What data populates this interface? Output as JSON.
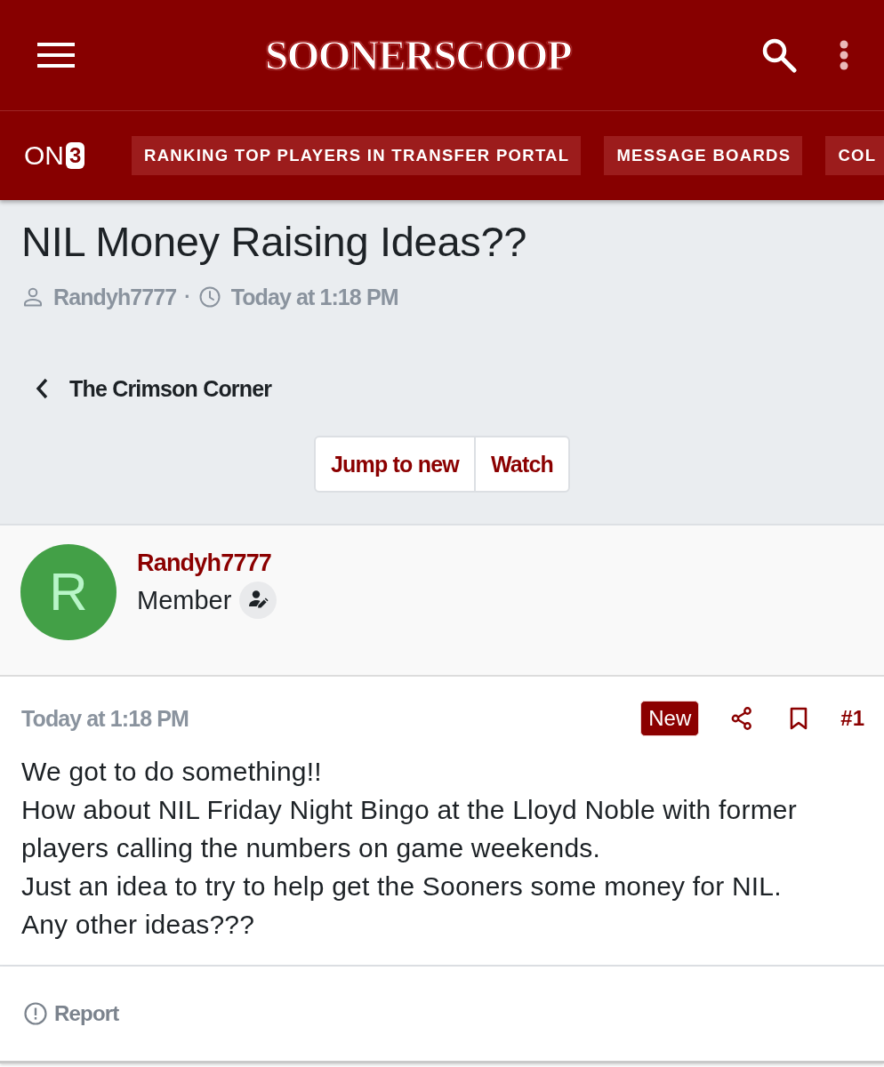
{
  "header": {
    "logo": "SOONERSCOOP"
  },
  "nav": {
    "brand": {
      "text": "ON",
      "badge": "3"
    },
    "links": [
      "RANKING TOP PLAYERS IN TRANSFER PORTAL",
      "MESSAGE BOARDS",
      "COL"
    ]
  },
  "thread": {
    "title": "NIL Money Raising Ideas??",
    "author": "Randyh7777",
    "separator": "·",
    "time": "Today at 1:18 PM"
  },
  "breadcrumb": {
    "label": "The Crimson Corner"
  },
  "actions": [
    "Jump to new",
    "Watch"
  ],
  "post": {
    "author": {
      "initial": "R",
      "name": "Randyh7777",
      "role": "Member"
    },
    "time": "Today at 1:18 PM",
    "badge": "New",
    "number": "#1",
    "lines": [
      "We got to do something!!",
      "How about NIL Friday Night Bingo at the Lloyd Noble with former players calling the numbers on game weekends.",
      "Just an idea to try to help get the Sooners some money for NIL.",
      "Any other ideas???"
    ],
    "footer": {
      "label": "Report"
    }
  }
}
